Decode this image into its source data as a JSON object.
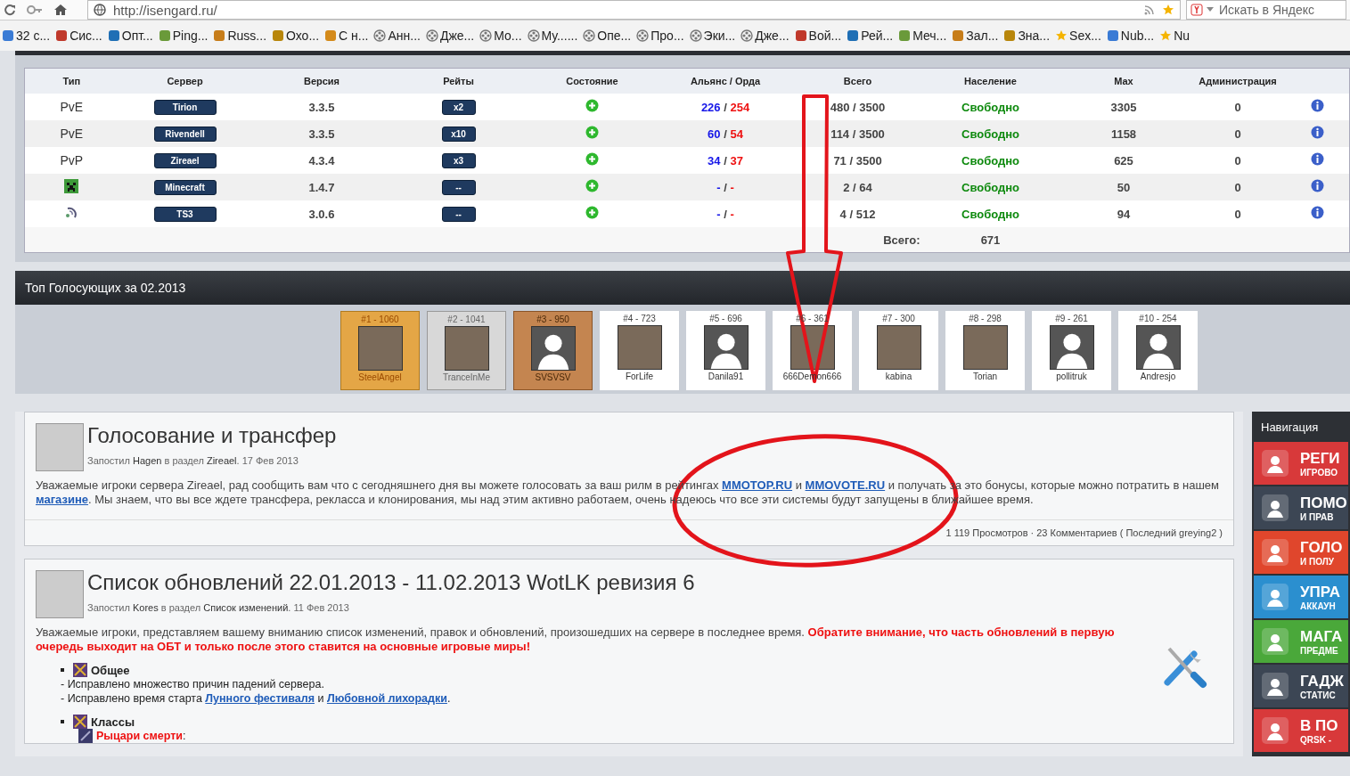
{
  "browser": {
    "address": "http://isengard.ru/",
    "search_placeholder": "Искать в Яндекс",
    "bookmarks": [
      {
        "label": "32 с...",
        "kind": "site"
      },
      {
        "label": "Сис...",
        "kind": "site"
      },
      {
        "label": "Опт...",
        "kind": "site"
      },
      {
        "label": "Ping...",
        "kind": "site"
      },
      {
        "label": "Russ...",
        "kind": "site"
      },
      {
        "label": "Охо...",
        "kind": "site"
      },
      {
        "label": "С н...",
        "kind": "site"
      },
      {
        "label": "Анн...",
        "kind": "reel"
      },
      {
        "label": "Дже...",
        "kind": "reel"
      },
      {
        "label": "Мо...",
        "kind": "reel"
      },
      {
        "label": "Му......",
        "kind": "reel"
      },
      {
        "label": "Опе...",
        "kind": "reel"
      },
      {
        "label": "Про...",
        "kind": "reel"
      },
      {
        "label": "Эки...",
        "kind": "reel"
      },
      {
        "label": "Дже...",
        "kind": "reel"
      },
      {
        "label": "Вой...",
        "kind": "site"
      },
      {
        "label": "Рей...",
        "kind": "site"
      },
      {
        "label": "Меч...",
        "kind": "site"
      },
      {
        "label": "Зал...",
        "kind": "site"
      },
      {
        "label": "Зна...",
        "kind": "site"
      },
      {
        "label": "Sex...",
        "kind": "star"
      },
      {
        "label": "Nub...",
        "kind": "site"
      },
      {
        "label": "Nu",
        "kind": "star"
      }
    ]
  },
  "servers": {
    "columns": [
      "Тип",
      "Сервер",
      "Версия",
      "Рейты",
      "Состояние",
      "Альянс / Орда",
      "Всего",
      "Население",
      "Max",
      "Администрация"
    ],
    "rows": [
      {
        "kind": "text",
        "type": "PvE",
        "server": "Tirion",
        "version": "3.3.5",
        "rates": "x2",
        "online": true,
        "alliance": "226",
        "separator": "/",
        "horde": "254",
        "total": "480 / 3500",
        "population": "Свободно",
        "max": "3305",
        "admins": "0"
      },
      {
        "kind": "text",
        "type": "PvE",
        "server": "Rivendell",
        "version": "3.3.5",
        "rates": "x10",
        "online": true,
        "alliance": "60",
        "separator": "/",
        "horde": "54",
        "total": "114 / 3500",
        "population": "Свободно",
        "max": "1158",
        "admins": "0"
      },
      {
        "kind": "text",
        "type": "PvP",
        "server": "Zireael",
        "version": "4.3.4",
        "rates": "x3",
        "online": true,
        "alliance": "34",
        "separator": "/",
        "horde": "37",
        "total": "71 / 3500",
        "population": "Свободно",
        "max": "625",
        "admins": "0"
      },
      {
        "kind": "minecraft",
        "server": "Minecraft",
        "version": "1.4.7",
        "rates": "--",
        "online": true,
        "alliance": "-",
        "separator": "/",
        "horde": "-",
        "total": "2 / 64",
        "population": "Свободно",
        "max": "50",
        "admins": "0"
      },
      {
        "kind": "teamspeak",
        "server": "TS3",
        "version": "3.0.6",
        "rates": "--",
        "online": true,
        "alliance": "-",
        "separator": "/",
        "horde": "-",
        "total": "4 / 512",
        "population": "Свободно",
        "max": "94",
        "admins": "0"
      }
    ],
    "sum_label": "Всего:",
    "sum_value": "671"
  },
  "voters": {
    "title": "Топ Голосующих за 02.2013",
    "items": [
      {
        "rank": "#1 - 1060",
        "name": "SteelAngel",
        "kind": "gold",
        "default_avatar": false
      },
      {
        "rank": "#2 - 1041",
        "name": "TranceInMe",
        "kind": "silver",
        "default_avatar": false
      },
      {
        "rank": "#3 - 950",
        "name": "SVSVSV",
        "kind": "bronze",
        "default_avatar": true
      },
      {
        "rank": "#4 - 723",
        "name": "ForLife",
        "kind": "plain",
        "default_avatar": false
      },
      {
        "rank": "#5 - 696",
        "name": "Danila91",
        "kind": "plain",
        "default_avatar": true
      },
      {
        "rank": "#6 - 361",
        "name": "666Demon666",
        "kind": "plain",
        "default_avatar": false
      },
      {
        "rank": "#7 - 300",
        "name": "kabina",
        "kind": "plain",
        "default_avatar": false
      },
      {
        "rank": "#8 - 298",
        "name": "Torian",
        "kind": "plain",
        "default_avatar": false
      },
      {
        "rank": "#9 - 261",
        "name": "pollitruk",
        "kind": "plain",
        "default_avatar": true
      },
      {
        "rank": "#10 - 254",
        "name": "Andresjo",
        "kind": "plain",
        "default_avatar": true
      }
    ]
  },
  "posts": [
    {
      "title": "Голосование и трансфер",
      "meta": "Запостил **Hagen** в раздел **Zireael**. 17 Фев 2013",
      "body": [
        {
          "kind": "text",
          "text": "Уважаемые игроки сервера Zireael, рад сообщить вам что с сегодняшнего дня вы можете голосовать за ваш рилм в рейтингах "
        },
        {
          "kind": "link",
          "text": "MMOTOP.RU"
        },
        {
          "kind": "text",
          "text": " и "
        },
        {
          "kind": "link",
          "text": "MMOVOTE.RU"
        },
        {
          "kind": "text",
          "text": " и получать за это бонусы, которые можно потратить в нашем "
        },
        {
          "kind": "link",
          "text": "магазине"
        },
        {
          "kind": "text",
          "text": ". Мы знаем, что вы все ждете трансфера, рекласса и клонирования, мы над этим активно работаем, очень надеюсь что все эти системы будут запущены в ближайшее время."
        }
      ],
      "footer": "1   119 Просмотров · 23 Комментариев ( Последний greying2 )"
    },
    {
      "title": "Список обновлений 22.01.2013 - 11.02.2013 WotLK ревизия 6",
      "meta": "Запостил **Kores** в раздел **Список изменений**. 11 Фев 2013",
      "body": [
        {
          "kind": "text",
          "text": "Уважаемые игроки, представляем вашему вниманию список изменений, правок и обновлений, произошедших на сервере в последнее время. "
        },
        {
          "kind": "alert",
          "text": "Обратите внимание, что часть обновлений в первую очередь выходит на ОБТ и только после этого ставится на основные игровые миры!"
        }
      ],
      "sections": [
        {
          "heading": "Общее",
          "lines": [
            [
              {
                "kind": "text",
                "text": "- Исправлено множество причин падений сервера."
              }
            ],
            [
              {
                "kind": "text",
                "text": "- Исправлено время старта "
              },
              {
                "kind": "link",
                "text": "Лунного фестиваля"
              },
              {
                "kind": "text",
                "text": " и "
              },
              {
                "kind": "link",
                "text": "Любовной лихорадки"
              },
              {
                "kind": "text",
                "text": "."
              }
            ]
          ]
        },
        {
          "heading": "Классы",
          "subheading": "Рыцари смерти",
          "subheading_end": ":"
        }
      ]
    }
  ],
  "navigation": {
    "title": "Навигация",
    "items": [
      {
        "title": "РЕГИ",
        "subtitle": "ИГРОВО",
        "color": "#d8393a"
      },
      {
        "title": "ПОМО",
        "subtitle": "И ПРАВ",
        "color": "#3c4654"
      },
      {
        "title": "ГОЛО",
        "subtitle": "И ПОЛУ",
        "color": "#e0462c"
      },
      {
        "title": "УПРА",
        "subtitle": "АККАУН",
        "color": "#2b8fcf"
      },
      {
        "title": "МАГА",
        "subtitle": "ПРЕДМЕ",
        "color": "#4aa83a"
      },
      {
        "title": "ГАДЖ",
        "subtitle": "СТАТИС",
        "color": "#3c4654"
      },
      {
        "title": "В ПО",
        "subtitle": "QRSK -",
        "color": "#d8393a"
      }
    ]
  }
}
